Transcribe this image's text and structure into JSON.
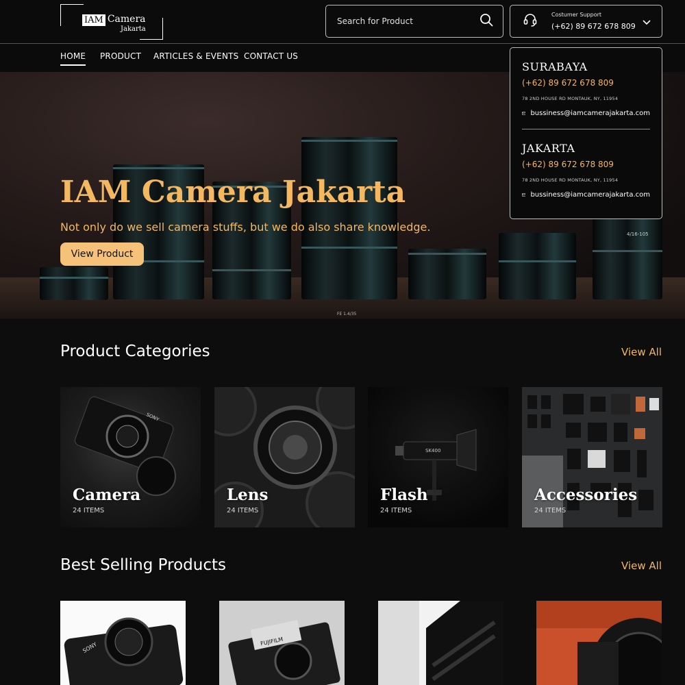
{
  "header": {
    "logo": {
      "line1_highlight": "IAM",
      "line1_rest": "Camera",
      "line2": "Jakarta"
    },
    "search": {
      "placeholder": "Search for Product"
    },
    "support": {
      "label": "Costumer Support",
      "phone": "(+62) 89 672 678 809"
    }
  },
  "nav": {
    "items": [
      {
        "label": "HOME",
        "active": true
      },
      {
        "label": "PRODUCT",
        "active": false
      },
      {
        "label": "ARTICLES & EVENTS",
        "active": false
      },
      {
        "label": "CONTACT US",
        "active": false
      }
    ]
  },
  "hero": {
    "title": "IAM Camera Jakarta",
    "subtitle": "Not only do we sell camera stuffs, but we do also share knowledge.",
    "button": "View Product",
    "lens_labels": [
      "FE 1.4/35",
      "4/16-105"
    ]
  },
  "support_dropdown": {
    "branches": [
      {
        "name": "SURABAYA",
        "phone": "(+62) 89 672 678 809",
        "address": "78 2ND HOUSE RD MONTAUK, NY, 11954",
        "email": "bussiness@iamcamerajakarta.com"
      },
      {
        "name": "JAKARTA",
        "phone": "(+62) 89 672 678 809",
        "address": "78 2ND HOUSE RD MONTAUK, NY, 11954",
        "email": "bussiness@iamcamerajakarta.com"
      }
    ]
  },
  "categories": {
    "title": "Product Categories",
    "view_all": "View All",
    "items": [
      {
        "name": "Camera",
        "count": "24 ITEMS",
        "brand_mark": "SONY"
      },
      {
        "name": "Lens",
        "count": "24 ITEMS"
      },
      {
        "name": "Flash",
        "count": "24 ITEMS",
        "brand_mark": "SK400"
      },
      {
        "name": "Accessories",
        "count": "24 ITEMS"
      }
    ]
  },
  "best_selling": {
    "title": "Best Selling Products",
    "view_all": "View All",
    "product_marks": [
      "SONY",
      "FUJIFILM"
    ]
  },
  "colors": {
    "accent": "#f4b860",
    "button_bg": "#f6c27a",
    "page_bg": "#0d0d0d"
  }
}
